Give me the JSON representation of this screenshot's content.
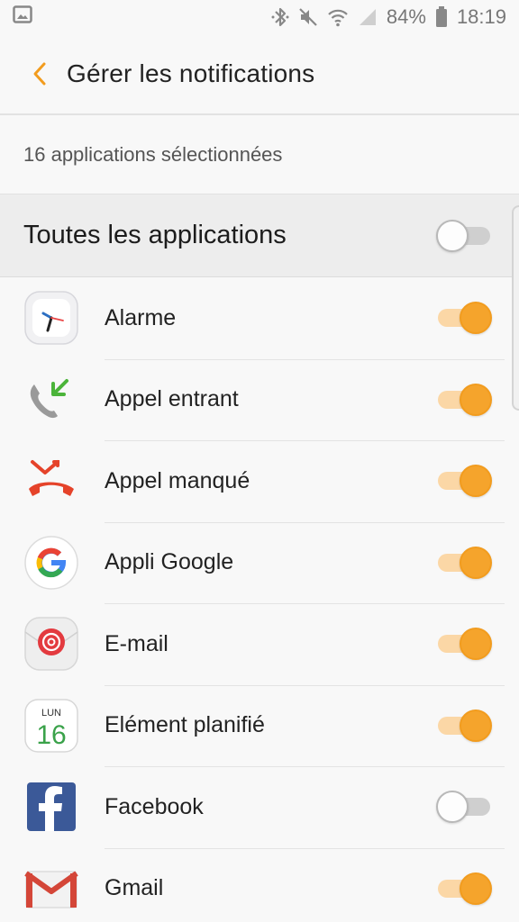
{
  "status_bar": {
    "battery_percent": "84%",
    "time": "18:19",
    "icons": [
      "gallery-icon",
      "bluetooth-icon",
      "mute-icon",
      "wifi-icon",
      "signal-icon",
      "battery-icon"
    ]
  },
  "header": {
    "back_icon": "chevron-left-icon",
    "title": "Gérer les notifications"
  },
  "subtitle": "16 applications sélectionnées",
  "all_apps": {
    "label": "Toutes les applications",
    "enabled": false
  },
  "accent_color": "#f5a42c",
  "apps": [
    {
      "label": "Alarme",
      "icon": "alarm-clock-icon",
      "enabled": true
    },
    {
      "label": "Appel entrant",
      "icon": "incoming-call-icon",
      "enabled": true
    },
    {
      "label": "Appel manqué",
      "icon": "missed-call-icon",
      "enabled": true
    },
    {
      "label": "Appli Google",
      "icon": "google-icon",
      "enabled": true
    },
    {
      "label": "E-mail",
      "icon": "email-icon",
      "enabled": true
    },
    {
      "label": "Elément planifié",
      "icon": "calendar-icon",
      "enabled": true,
      "icon_text": {
        "day": "LUN",
        "date": "16"
      }
    },
    {
      "label": "Facebook",
      "icon": "facebook-icon",
      "enabled": false
    },
    {
      "label": "Gmail",
      "icon": "gmail-icon",
      "enabled": true
    }
  ]
}
